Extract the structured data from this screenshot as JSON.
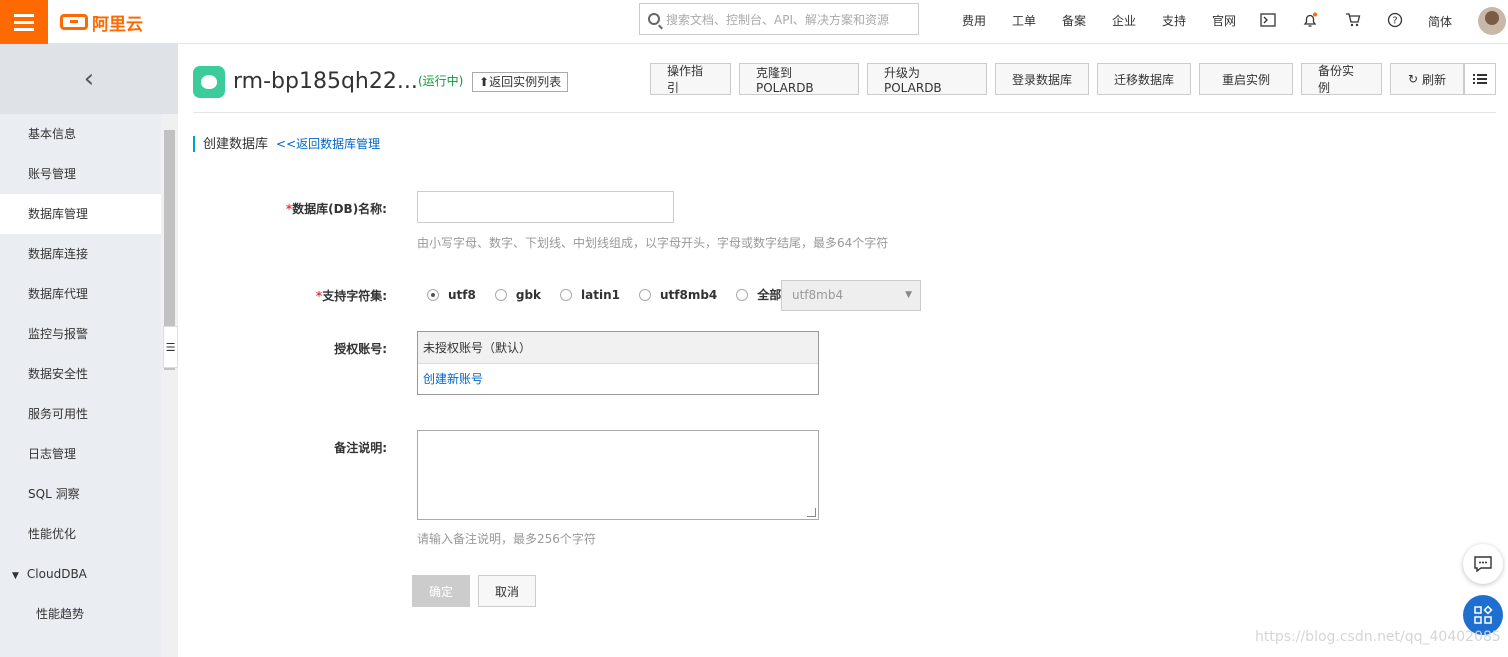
{
  "header": {
    "logo_text": "阿里云",
    "search_placeholder": "搜索文档、控制台、API、解决方案和资源",
    "nav": [
      "费用",
      "工单",
      "备案",
      "企业",
      "支持",
      "官网"
    ],
    "lang": "简体",
    "icons": [
      "terminal-icon",
      "bell-icon",
      "cart-icon",
      "help-icon"
    ],
    "accent": "#ff6a00"
  },
  "sidebar": {
    "back": "‹",
    "items": [
      {
        "label": "基本信息"
      },
      {
        "label": "账号管理"
      },
      {
        "label": "数据库管理",
        "active": true
      },
      {
        "label": "数据库连接"
      },
      {
        "label": "数据库代理"
      },
      {
        "label": "监控与报警"
      },
      {
        "label": "数据安全性"
      },
      {
        "label": "服务可用性"
      },
      {
        "label": "日志管理"
      },
      {
        "label": "SQL 洞察"
      },
      {
        "label": "性能优化"
      },
      {
        "label": "CloudDBA"
      },
      {
        "label": "性能趋势"
      }
    ]
  },
  "instance": {
    "name": "rm-bp185qh22...",
    "status": "(运行中)",
    "back_link": "返回实例列表",
    "status_color": "#0a9a3b"
  },
  "toolbar": {
    "buttons": [
      "操作指引",
      "克隆到POLARDB",
      "升级为POLARDB",
      "登录数据库",
      "迁移数据库",
      "重启实例",
      "备份实例",
      "刷新"
    ]
  },
  "section": {
    "title": "创建数据库",
    "back_link": "<<返回数据库管理"
  },
  "form": {
    "db_name_label": "数据库(DB)名称:",
    "db_name_value": "",
    "db_name_hint": "由小写字母、数字、下划线、中划线组成，以字母开头，字母或数字结尾，最多64个字符",
    "charset_label": "支持字符集:",
    "charsets": [
      "utf8",
      "gbk",
      "latin1",
      "utf8mb4",
      "全部"
    ],
    "charset_selected": "utf8",
    "charset_select_value": "utf8mb4",
    "account_label": "授权账号:",
    "account_default": "未授权账号（默认）",
    "account_create": "创建新账号",
    "remark_label": "备注说明:",
    "remark_value": "",
    "remark_hint": "请输入备注说明，最多256个字符",
    "ok": "确定",
    "cancel": "取消",
    "required_mark": "*"
  },
  "watermark": "https://blog.csdn.net/qq_40402085"
}
